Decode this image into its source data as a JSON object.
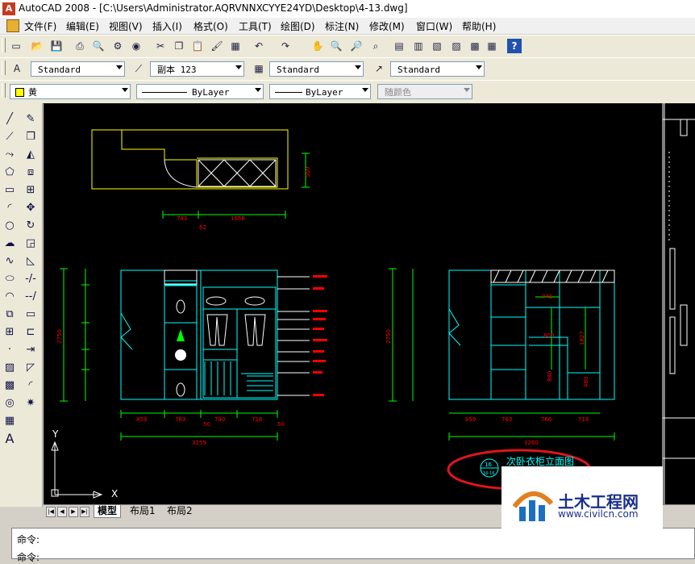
{
  "window": {
    "title": "AutoCAD 2008 - [C:\\Users\\Administrator.AQRVNNXCYYE24YD\\Desktop\\4-13.dwg]"
  },
  "menu": [
    "文件(F)",
    "编辑(E)",
    "视图(V)",
    "插入(I)",
    "格式(O)",
    "工具(T)",
    "绘图(D)",
    "标注(N)",
    "修改(M)",
    "窗口(W)",
    "帮助(H)"
  ],
  "styles_toolbar": {
    "text_style": "Standard",
    "dim_style": "副本 123",
    "table_style": "Standard",
    "multileader_style": "Standard"
  },
  "properties_toolbar": {
    "layer": "黄",
    "linetype": "ByLayer",
    "lineweight": "ByLayer",
    "plot_style": "随颜色"
  },
  "drawing": {
    "top_dims": [
      "783",
      "1658",
      "550",
      "62"
    ],
    "front_dims_bottom": [
      "859",
      "763",
      "50",
      "780",
      "718",
      "50"
    ],
    "front_total": "3259",
    "front_height": "2750",
    "side_dims_bottom": [
      "859",
      "763",
      "766",
      "718"
    ],
    "side_total": "3260",
    "side_height": "2750",
    "inner_dims": [
      "749",
      "800",
      "1827",
      "880",
      "480"
    ],
    "caption": "次卧衣柜立面图",
    "caption_badge_top": "16",
    "caption_badge_bottom": "16-16"
  },
  "ucs": {
    "x": "X",
    "y": "Y"
  },
  "layout_tabs": [
    "模型",
    "布局1",
    "布局2"
  ],
  "command": {
    "line1": "命令:",
    "line2": "命令:"
  },
  "watermark": {
    "brand": "土木工程网",
    "url": "www.civilcn.com"
  },
  "colors": {
    "canvas": "#000000",
    "cad_cyan": "#00ffff",
    "cad_yellow": "#ffff00",
    "cad_red": "#ff0000",
    "cad_white": "#ffffff",
    "cad_green": "#00ff00",
    "caption_ring": "#e0141e"
  }
}
